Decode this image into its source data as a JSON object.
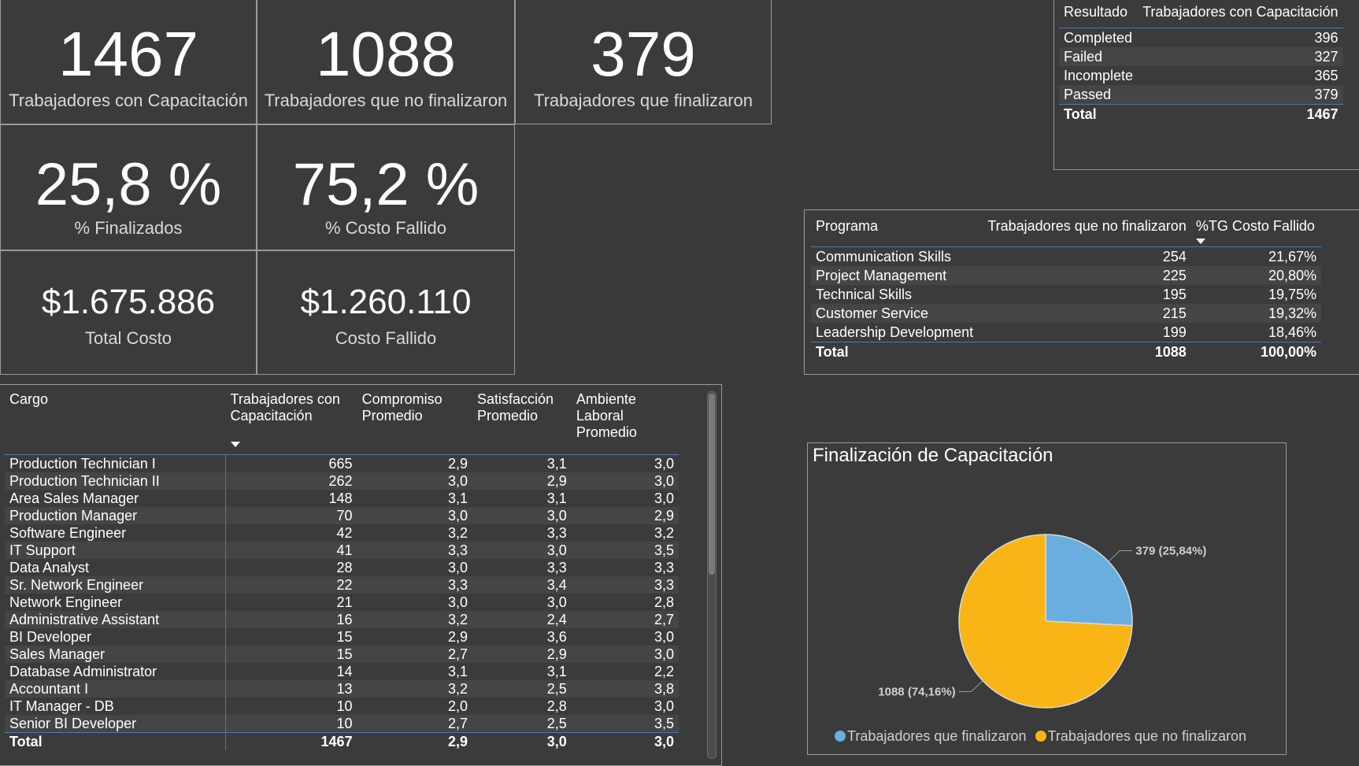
{
  "kpis": {
    "trained": {
      "value": "1467",
      "label": "Trabajadores con Capacitación"
    },
    "not_finished": {
      "value": "1088",
      "label": "Trabajadores que no finalizaron"
    },
    "finished": {
      "value": "379",
      "label": "Trabajadores que finalizaron"
    },
    "pct_finished": {
      "value": "25,8 %",
      "label": "% Finalizados"
    },
    "pct_cost_failed": {
      "value": "75,2 %",
      "label": "% Costo Fallido"
    },
    "total_cost": {
      "value": "$1.675.886",
      "label": "Total Costo"
    },
    "cost_failed": {
      "value": "$1.260.110",
      "label": "Costo Fallido"
    }
  },
  "resultado_table": {
    "headers": [
      "Resultado",
      "Trabajadores con Capacitación"
    ],
    "rows": [
      [
        "Completed",
        "396"
      ],
      [
        "Failed",
        "327"
      ],
      [
        "Incomplete",
        "365"
      ],
      [
        "Passed",
        "379"
      ]
    ],
    "total": [
      "Total",
      "1467"
    ]
  },
  "programa_table": {
    "headers": [
      "Programa",
      "Trabajadores que no finalizaron",
      "%TG Costo Fallido"
    ],
    "rows": [
      [
        "Communication Skills",
        "254",
        "21,67%"
      ],
      [
        "Project Management",
        "225",
        "20,80%"
      ],
      [
        "Technical Skills",
        "195",
        "19,75%"
      ],
      [
        "Customer Service",
        "215",
        "19,32%"
      ],
      [
        "Leadership Development",
        "199",
        "18,46%"
      ]
    ],
    "total": [
      "Total",
      "1088",
      "100,00%"
    ]
  },
  "cargo_table": {
    "headers": [
      "Cargo",
      "Trabajadores con Capacitación",
      "Compromiso Promedio",
      "Satisfacción Promedio",
      "Ambiente Laboral Promedio"
    ],
    "rows": [
      [
        "Production Technician I",
        "665",
        "2,9",
        "3,1",
        "3,0"
      ],
      [
        "Production Technician II",
        "262",
        "3,0",
        "2,9",
        "3,0"
      ],
      [
        "Area Sales Manager",
        "148",
        "3,1",
        "3,1",
        "3,0"
      ],
      [
        "Production Manager",
        "70",
        "3,0",
        "3,0",
        "2,9"
      ],
      [
        "Software Engineer",
        "42",
        "3,2",
        "3,3",
        "3,2"
      ],
      [
        "IT Support",
        "41",
        "3,3",
        "3,0",
        "3,5"
      ],
      [
        "Data Analyst",
        "28",
        "3,0",
        "3,3",
        "3,3"
      ],
      [
        "Sr. Network Engineer",
        "22",
        "3,3",
        "3,4",
        "3,3"
      ],
      [
        "Network Engineer",
        "21",
        "3,0",
        "3,0",
        "2,8"
      ],
      [
        "Administrative Assistant",
        "16",
        "3,2",
        "2,4",
        "2,7"
      ],
      [
        "BI Developer",
        "15",
        "2,9",
        "3,6",
        "3,0"
      ],
      [
        "Sales Manager",
        "15",
        "2,7",
        "2,9",
        "3,0"
      ],
      [
        "Database Administrator",
        "14",
        "3,1",
        "3,1",
        "2,2"
      ],
      [
        "Accountant I",
        "13",
        "3,2",
        "2,5",
        "3,8"
      ],
      [
        "IT Manager - DB",
        "10",
        "2,0",
        "2,8",
        "3,0"
      ],
      [
        "Senior BI Developer",
        "10",
        "2,7",
        "2,5",
        "3,5"
      ]
    ],
    "total": [
      "Total",
      "1467",
      "2,9",
      "3,0",
      "3,0"
    ]
  },
  "chart_data": {
    "type": "pie",
    "title": "Finalización de Capacitación",
    "slices": [
      {
        "name": "Trabajadores que finalizaron",
        "value": 379,
        "label": "379 (25,84%)",
        "color": "#6aaee0"
      },
      {
        "name": "Trabajadores que no finalizaron",
        "value": 1088,
        "label": "1088 (74,16%)",
        "color": "#f9b515"
      }
    ],
    "legend": "bottom"
  }
}
